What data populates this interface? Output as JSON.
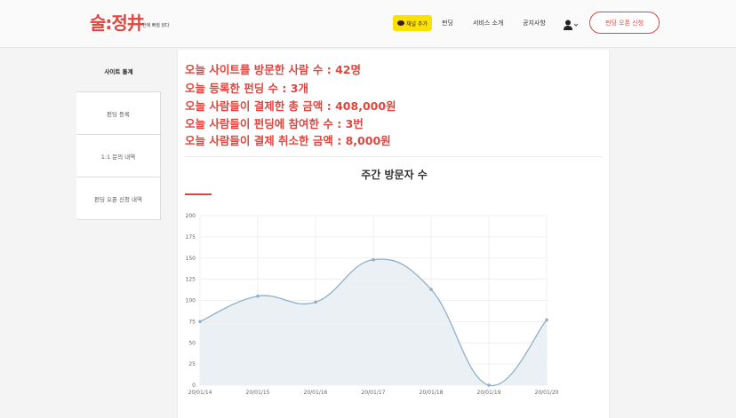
{
  "header": {
    "logo": "술:정井",
    "logo_sub": "안에 빠질 닭다",
    "kakao_label": "채널 추가",
    "nav": [
      "펀딩",
      "서비스 소개",
      "공지사항"
    ],
    "user_caret": "⌄",
    "cta": "펀딩 오픈 신청"
  },
  "sidebar": {
    "items": [
      "사이트 통계",
      "펀딩 등록",
      "1:1 문의 내역",
      "펀딩 오픈 신청 내역"
    ]
  },
  "stats": [
    "오늘 사이트를 방문한 사람 수 : 42명",
    "오늘 등록한 펀딩 수 : 3개",
    "오늘 사람들이 결제한 총 금액 : 408,000원",
    "오늘 사람들이 펀딩에 참여한 수 : 3번",
    "오늘 사람들이 결제 취소한 금액 : 8,000원"
  ],
  "colors": {
    "accent": "#e0463f",
    "line": "#8fb0c8",
    "fill": "#e9eef3"
  },
  "chart_data": {
    "type": "area",
    "title": "주간 방문자 수",
    "categories": [
      "20/01/14",
      "20/01/15",
      "20/01/16",
      "20/01/17",
      "20/01/18",
      "20/01/19",
      "20/01/20"
    ],
    "values": [
      75,
      105,
      98,
      148,
      113,
      0,
      77
    ],
    "ylim": [
      0,
      200
    ],
    "yticks": [
      0,
      25,
      50,
      75,
      100,
      125,
      150,
      175,
      200
    ],
    "grid": true
  }
}
